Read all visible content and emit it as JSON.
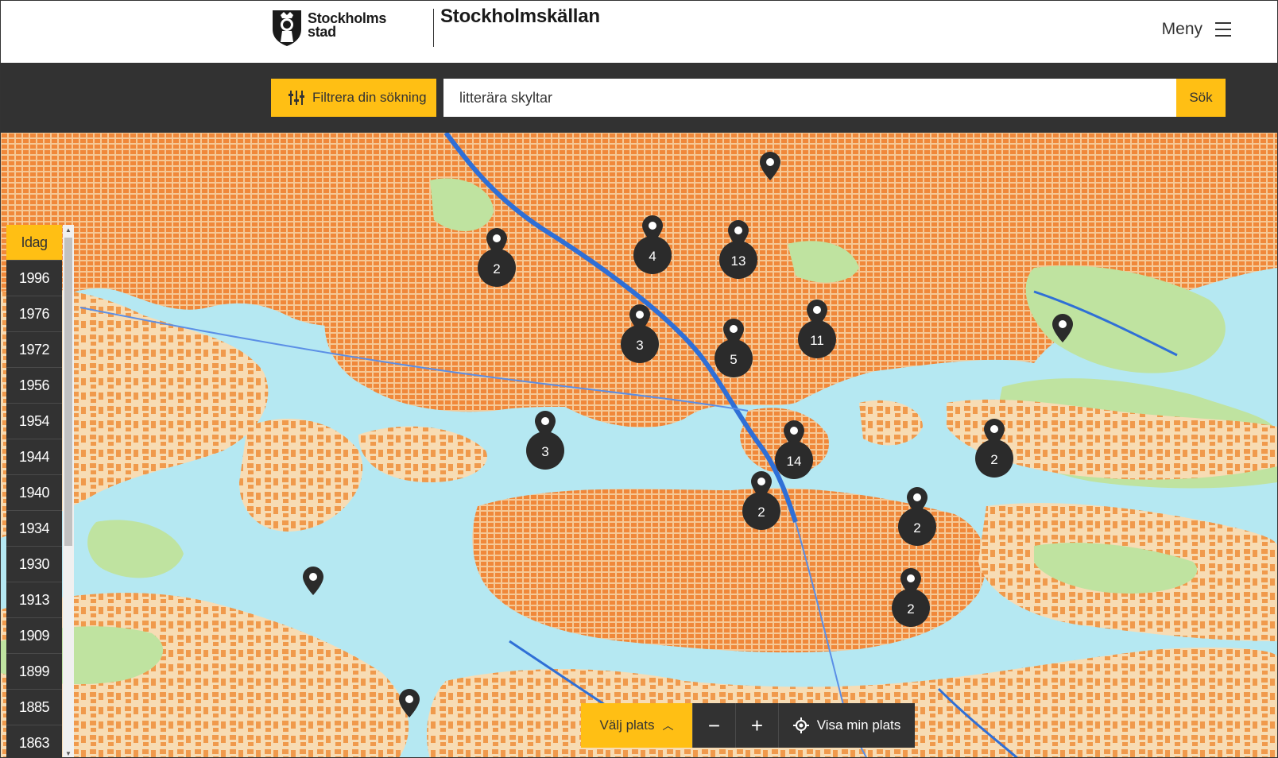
{
  "header": {
    "logo_line1": "Stockholms",
    "logo_line2": "stad",
    "site_title": "Stockholmskällan",
    "menu_label": "Meny"
  },
  "search": {
    "filter_label": "Filtrera din sökning",
    "query": "litterära skyltar",
    "submit_label": "Sök"
  },
  "timeline": {
    "items": [
      "Idag",
      "1996",
      "1976",
      "1972",
      "1956",
      "1954",
      "1944",
      "1940",
      "1934",
      "1930",
      "1913",
      "1909",
      "1899",
      "1885",
      "1863"
    ]
  },
  "map": {
    "clusters": [
      "2",
      "4",
      "13",
      "3",
      "5",
      "11",
      "3",
      "14",
      "2",
      "2",
      "2",
      "2"
    ]
  },
  "controls": {
    "choose_place": "Välj plats",
    "zoom_out": "−",
    "zoom_in": "+",
    "show_my_location": "Visa min plats"
  },
  "colors": {
    "accent": "#ffbf14",
    "dark": "#323232",
    "water": "#b5e8f2",
    "land": "#f5d7a8",
    "buildings": "#f0883a",
    "parks": "#bfe3a0"
  }
}
